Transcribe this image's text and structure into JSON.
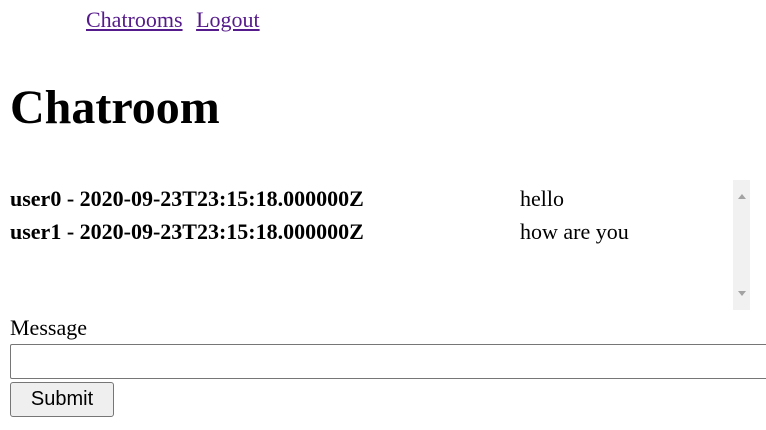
{
  "nav": {
    "chatrooms": "Chatrooms",
    "logout": "Logout"
  },
  "page_title": "Chatroom",
  "messages": [
    {
      "meta": "user0 - 2020-09-23T23:15:18.000000Z",
      "text": "hello"
    },
    {
      "meta": "user1 - 2020-09-23T23:15:18.000000Z",
      "text": "how are you"
    }
  ],
  "form": {
    "message_label": "Message",
    "message_value": "",
    "submit_label": "Submit"
  },
  "colors": {
    "link": "#551a8b",
    "scrollbar_track": "#f1f1f1",
    "button_bg": "#efefef"
  }
}
